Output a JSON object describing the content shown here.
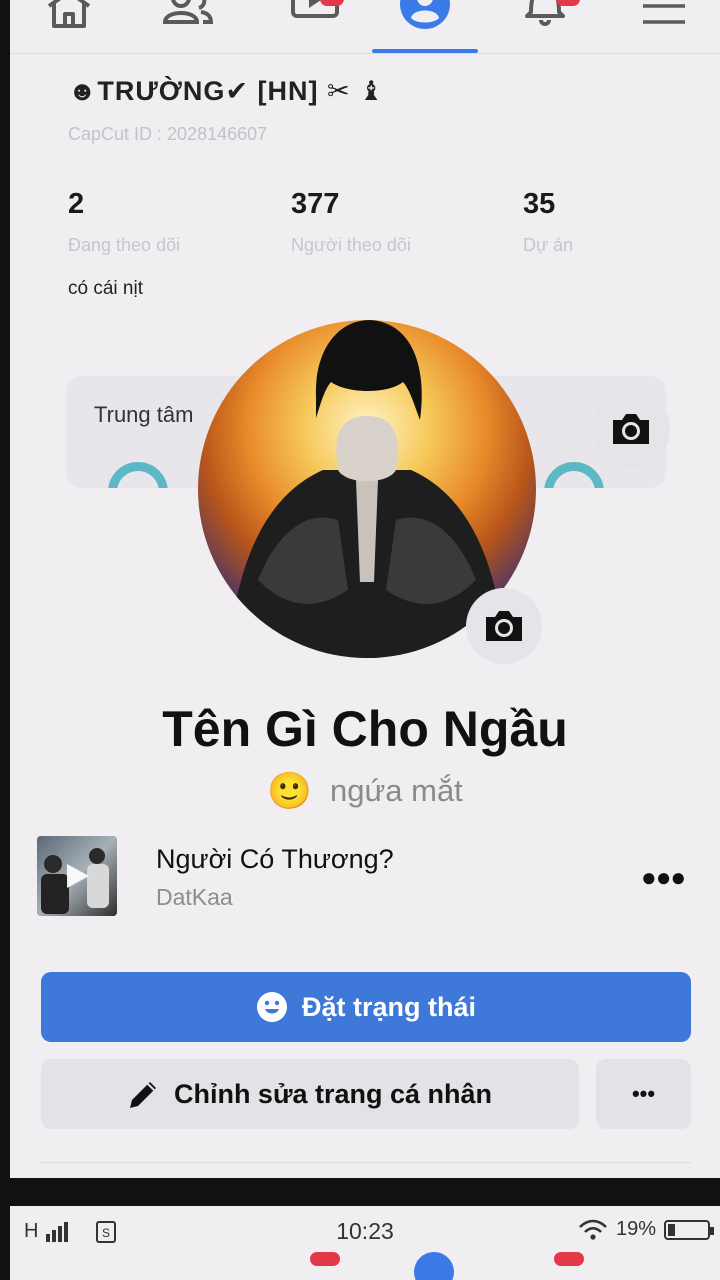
{
  "capcut": {
    "name": "☻TRƯỜNG✔ [HN] ✂ ♝",
    "id_text": "CapCut ID :  2028146607",
    "stats": [
      {
        "value": "2",
        "label": "Đang theo dõi"
      },
      {
        "value": "377",
        "label": "Người theo dõi"
      },
      {
        "value": "35",
        "label": "Dự án"
      }
    ],
    "bio": "có cái nịt",
    "center_title": "Trung tâm"
  },
  "nav": {
    "items": [
      "home-icon",
      "friends-icon",
      "watch-icon",
      "profile-icon",
      "notifications-icon",
      "menu-icon"
    ],
    "active": "profile-icon",
    "accent": "#3a7be8",
    "badge_color": "#e4384a"
  },
  "profile": {
    "name": "Tên Gì Cho Ngầu",
    "feeling_emoji": "🙂",
    "feeling_text": "ngứa mắt"
  },
  "music": {
    "title": "Người Có Thương?",
    "artist": "DatKaa"
  },
  "buttons": {
    "status_label": "Đặt trạng thái",
    "edit_label": "Chỉnh sửa trang cá nhân",
    "more_label": "•••",
    "status_color": "#3e78d8"
  },
  "statusbar": {
    "signal": "H",
    "time": "10:23",
    "battery": "19%",
    "battery_level": 0.19
  }
}
